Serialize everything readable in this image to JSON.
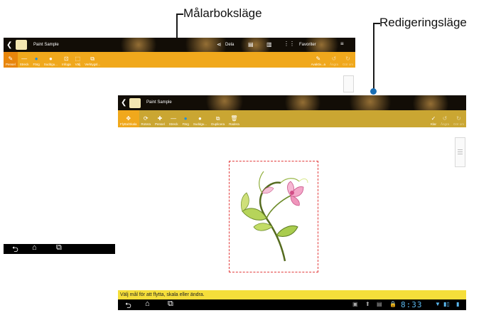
{
  "callouts": {
    "painter_mode": "Målarboksläge",
    "edit_mode": "Redigeringsläge"
  },
  "paint_screen": {
    "title": "Paint Sample",
    "actions": {
      "share": "Dela",
      "favorites": "Favoriter"
    },
    "tools": [
      "Pensel",
      "Streck",
      "Färg",
      "Suddgu...",
      "Infoga",
      "Välj",
      "Verktygsl..."
    ],
    "right_tools": [
      "Avaktiv...a",
      "Ångra",
      "Gör om"
    ]
  },
  "edit_screen": {
    "title": "Paint Sample",
    "tools": [
      "Flytta/Skala",
      "Rotera",
      "Pensel",
      "Streck",
      "Färg",
      "Suddgu...",
      "Duplicera",
      "Radera"
    ],
    "right_tools": [
      "Klar",
      "Ångra",
      "Gör om"
    ],
    "status_message": "Välj mål för att flytta, skala eller ändra.",
    "clock": "8:33"
  },
  "colors": {
    "toolbar_gold": "#caa632",
    "toolbar_orange": "#f0a81c",
    "status_yellow": "#f5de3a",
    "selection_red": "#e23b3b"
  }
}
